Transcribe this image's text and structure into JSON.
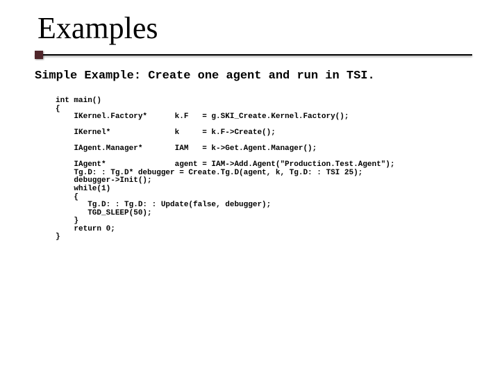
{
  "title": "Examples",
  "subtitle": "Simple Example: Create one agent and run in TSI.",
  "code": "int main()\n{\n    IKernel.Factory*      k.F   = g.SKI_Create.Kernel.Factory();\n\n    IKernel*              k     = k.F->Create();\n\n    IAgent.Manager*       IAM   = k->Get.Agent.Manager();\n\n    IAgent*               agent = IAM->Add.Agent(\"Production.Test.Agent\");\n    Tg.D: : Tg.D* debugger = Create.Tg.D(agent, k, Tg.D: : TSI 25);\n    debugger->Init();\n    while(1)\n    {\n       Tg.D: : Tg.D: : Update(false, debugger);\n       TGD_SLEEP(50);\n    }\n    return 0;\n}"
}
